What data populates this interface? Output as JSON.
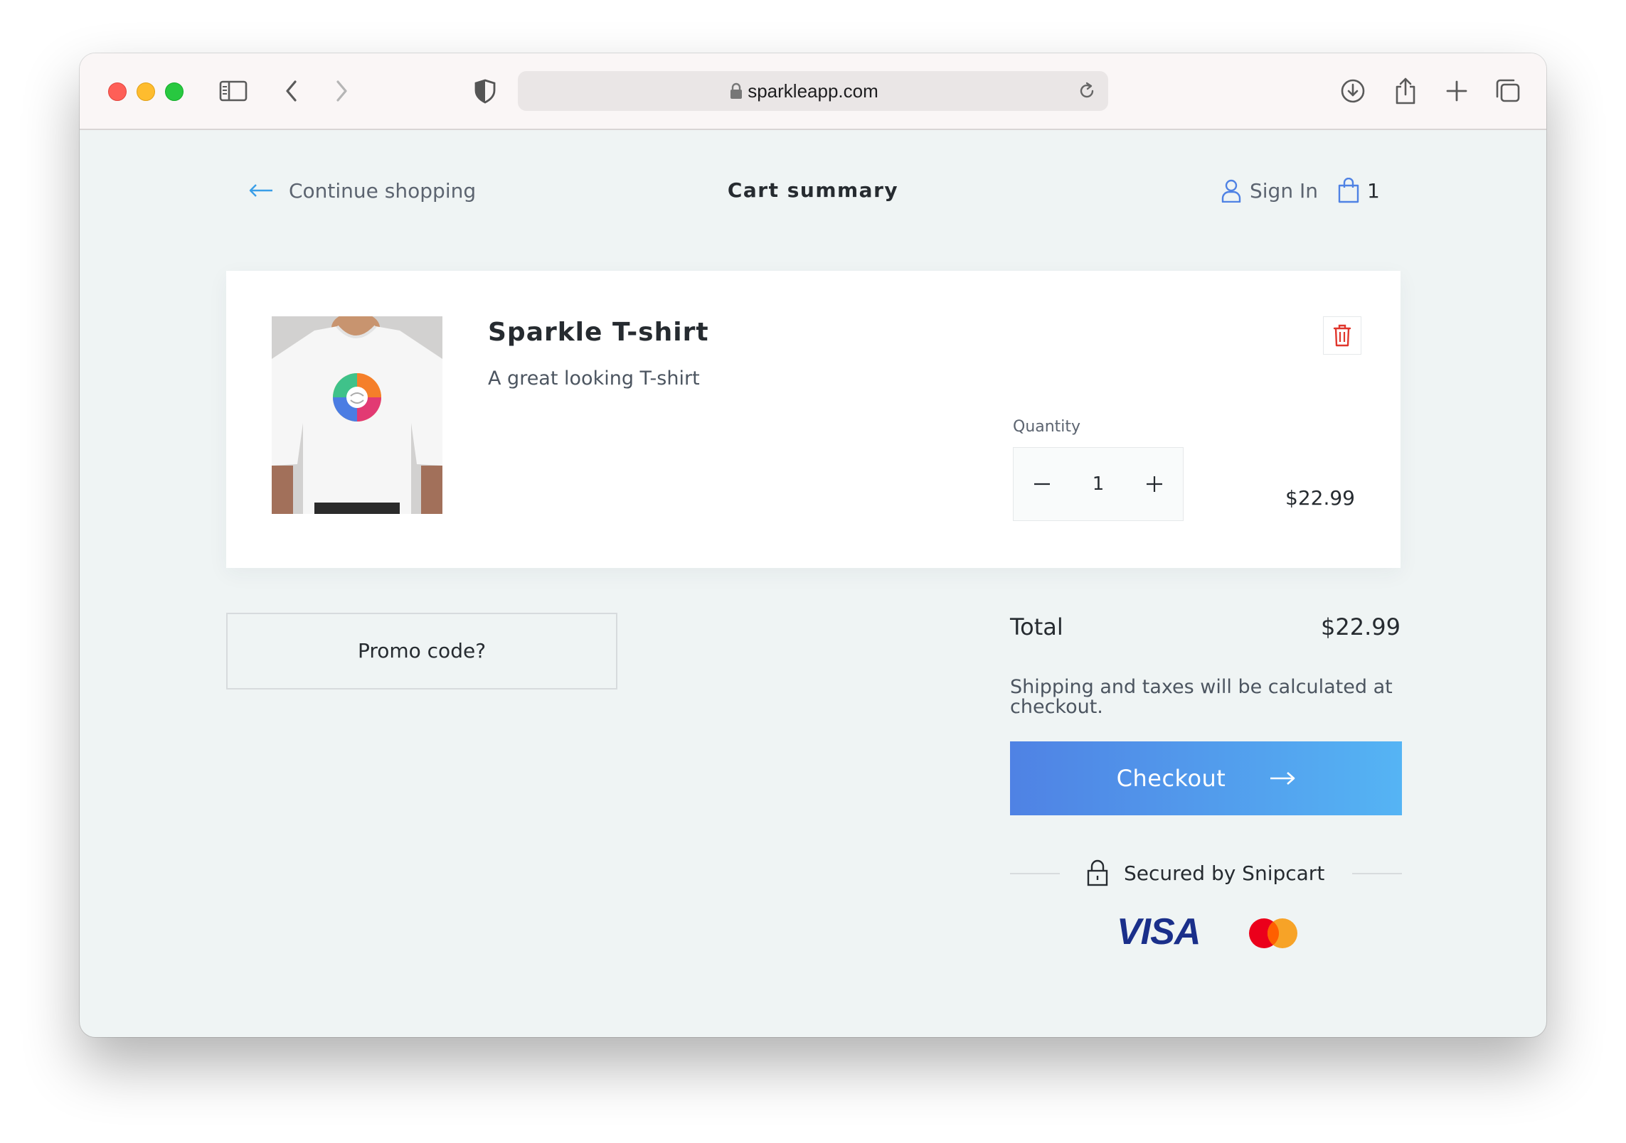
{
  "browser": {
    "url": "sparkleapp.com"
  },
  "header": {
    "back_label": "Continue shopping",
    "title": "Cart summary",
    "signin_label": "Sign In",
    "cart_count": "1"
  },
  "cart": {
    "items": [
      {
        "name": "Sparkle T-shirt",
        "description": "A great looking T-shirt",
        "quantity_label": "Quantity",
        "quantity": "1",
        "price": "$22.99"
      }
    ]
  },
  "summary": {
    "promo_label": "Promo code?",
    "total_label": "Total",
    "total_value": "$22.99",
    "shipping_note": "Shipping and taxes will be calculated at checkout.",
    "checkout_label": "Checkout",
    "secured_label": "Secured by Snipcart",
    "payment_methods": [
      "VISA",
      "mastercard"
    ]
  },
  "colors": {
    "accent_start": "#4f82e4",
    "accent_end": "#55b4f4",
    "delete": "#e0362c",
    "page_bg": "#eff4f4"
  }
}
